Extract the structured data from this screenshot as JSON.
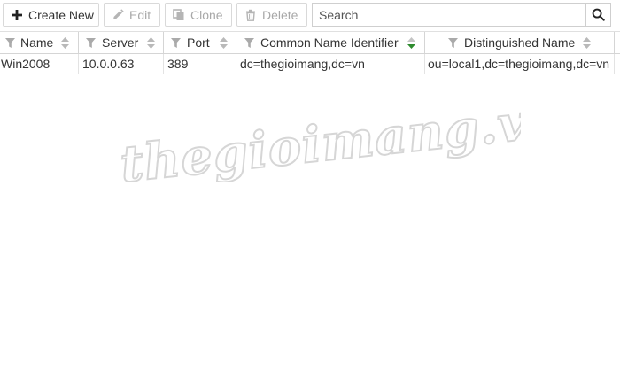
{
  "toolbar": {
    "create_new_label": "Create New",
    "edit_label": "Edit",
    "clone_label": "Clone",
    "delete_label": "Delete"
  },
  "search": {
    "placeholder": "Search"
  },
  "table": {
    "columns": [
      {
        "label": "Name",
        "sort": "none"
      },
      {
        "label": "Server",
        "sort": "none"
      },
      {
        "label": "Port",
        "sort": "none"
      },
      {
        "label": "Common Name Identifier",
        "sort": "descending"
      },
      {
        "label": "Distinguished Name",
        "sort": "none"
      }
    ],
    "rows": [
      [
        "Win2008",
        "10.0.0.63",
        "389",
        "dc=thegioimang,dc=vn",
        "ou=local1,dc=thegioimang,dc=vn"
      ]
    ]
  },
  "watermark": {
    "text": "thegioimang.vn"
  },
  "colors": {
    "sort_active": "#2e8b2e",
    "sort_inactive": "#b9b9b9",
    "disabled_text": "#a8a8a8",
    "border": "#d5d5d5"
  },
  "icons": [
    "plus-icon",
    "pencil-icon",
    "clone-icon",
    "trash-icon",
    "magnifier-icon",
    "filter-icon",
    "sort-icon"
  ]
}
